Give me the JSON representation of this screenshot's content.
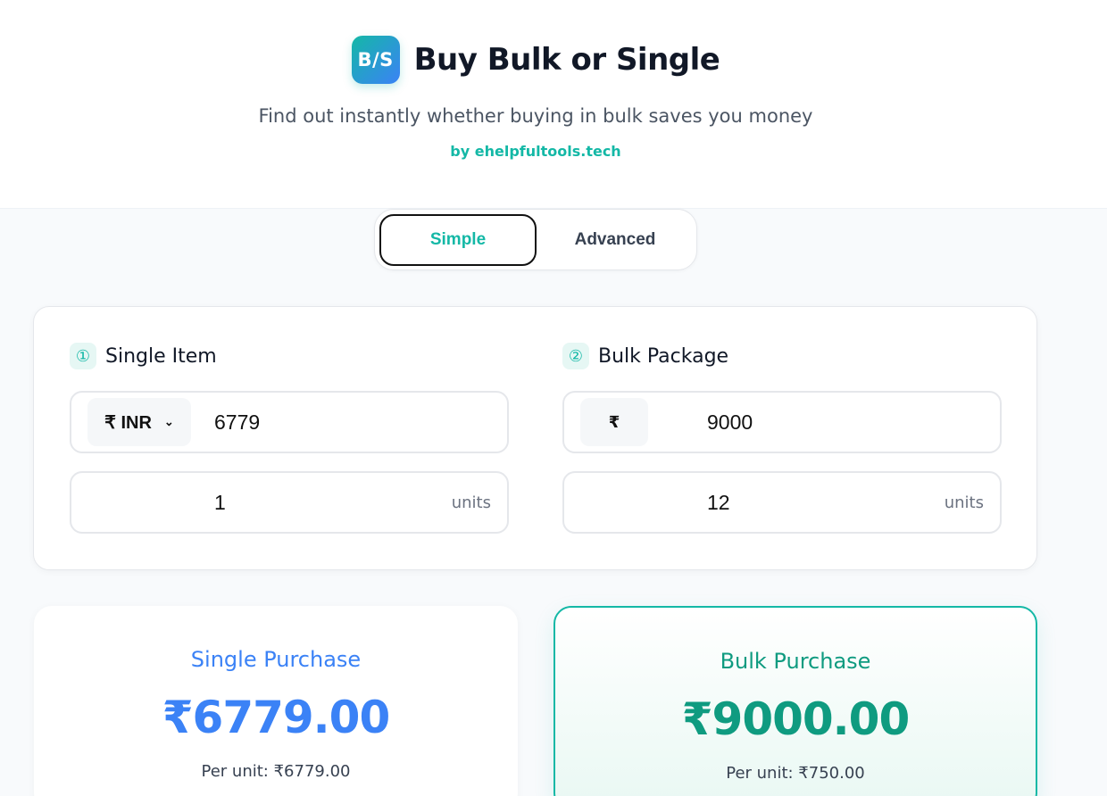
{
  "header": {
    "logo_text": "B/S",
    "title": "Buy Bulk or Single",
    "subtitle": "Find out instantly whether buying in bulk saves you money",
    "byline": "by ehelpfultools.tech"
  },
  "mode_toggle": {
    "simple_label": "Simple",
    "advanced_label": "Advanced",
    "active": "Simple"
  },
  "single_item": {
    "number": "①",
    "title": "Single Item",
    "currency_label": "₹ INR",
    "price": "6779",
    "quantity": "1",
    "units_label": "units"
  },
  "bulk_package": {
    "number": "②",
    "title": "Bulk Package",
    "currency_symbol": "₹",
    "price": "9000",
    "quantity": "12",
    "units_label": "units"
  },
  "results": {
    "single": {
      "title": "Single Purchase",
      "amount": "₹6779.00",
      "per_unit": "Per unit: ₹6779.00"
    },
    "bulk": {
      "title": "Bulk Purchase",
      "amount": "₹9000.00",
      "per_unit": "Per unit: ₹750.00"
    }
  },
  "colors": {
    "accent_teal": "#14b8a6",
    "accent_blue": "#3b82f6",
    "bulk_green": "#0f9b80"
  }
}
